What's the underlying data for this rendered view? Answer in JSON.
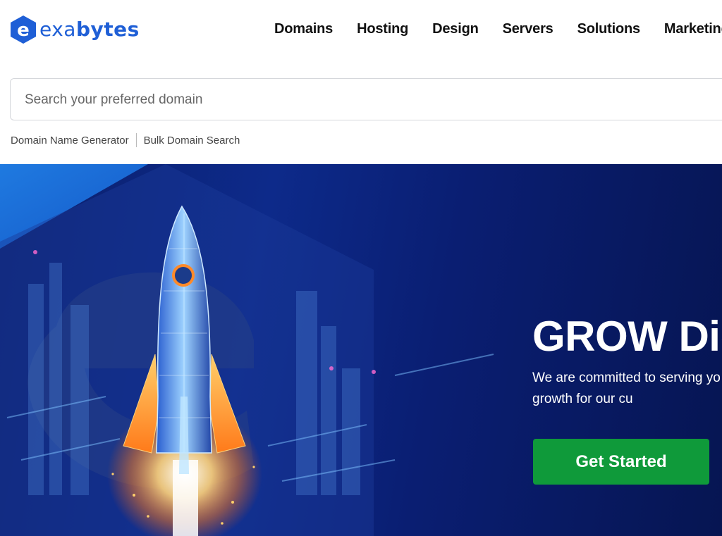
{
  "brand": {
    "name_part1": "exa",
    "name_part2": "bytes",
    "color": "#1f5fd6",
    "logo_icon": "exabytes-e-hexagon-icon"
  },
  "nav": {
    "items": [
      {
        "label": "Domains"
      },
      {
        "label": "Hosting"
      },
      {
        "label": "Design"
      },
      {
        "label": "Servers"
      },
      {
        "label": "Solutions"
      },
      {
        "label": "Marketing T"
      }
    ]
  },
  "search": {
    "placeholder": "Search your preferred domain",
    "value": "",
    "links": [
      {
        "label": "Domain Name Generator"
      },
      {
        "label": "Bulk Domain Search"
      }
    ]
  },
  "hero": {
    "title": "GROW Dig",
    "description": "We are committed to serving yo driving digital growth for our cu",
    "cta_label": "Get Started",
    "cta_color": "#0f9a3a",
    "background_color": "#0d2a8a",
    "illustration": "rocket-launch-city-illustration"
  }
}
